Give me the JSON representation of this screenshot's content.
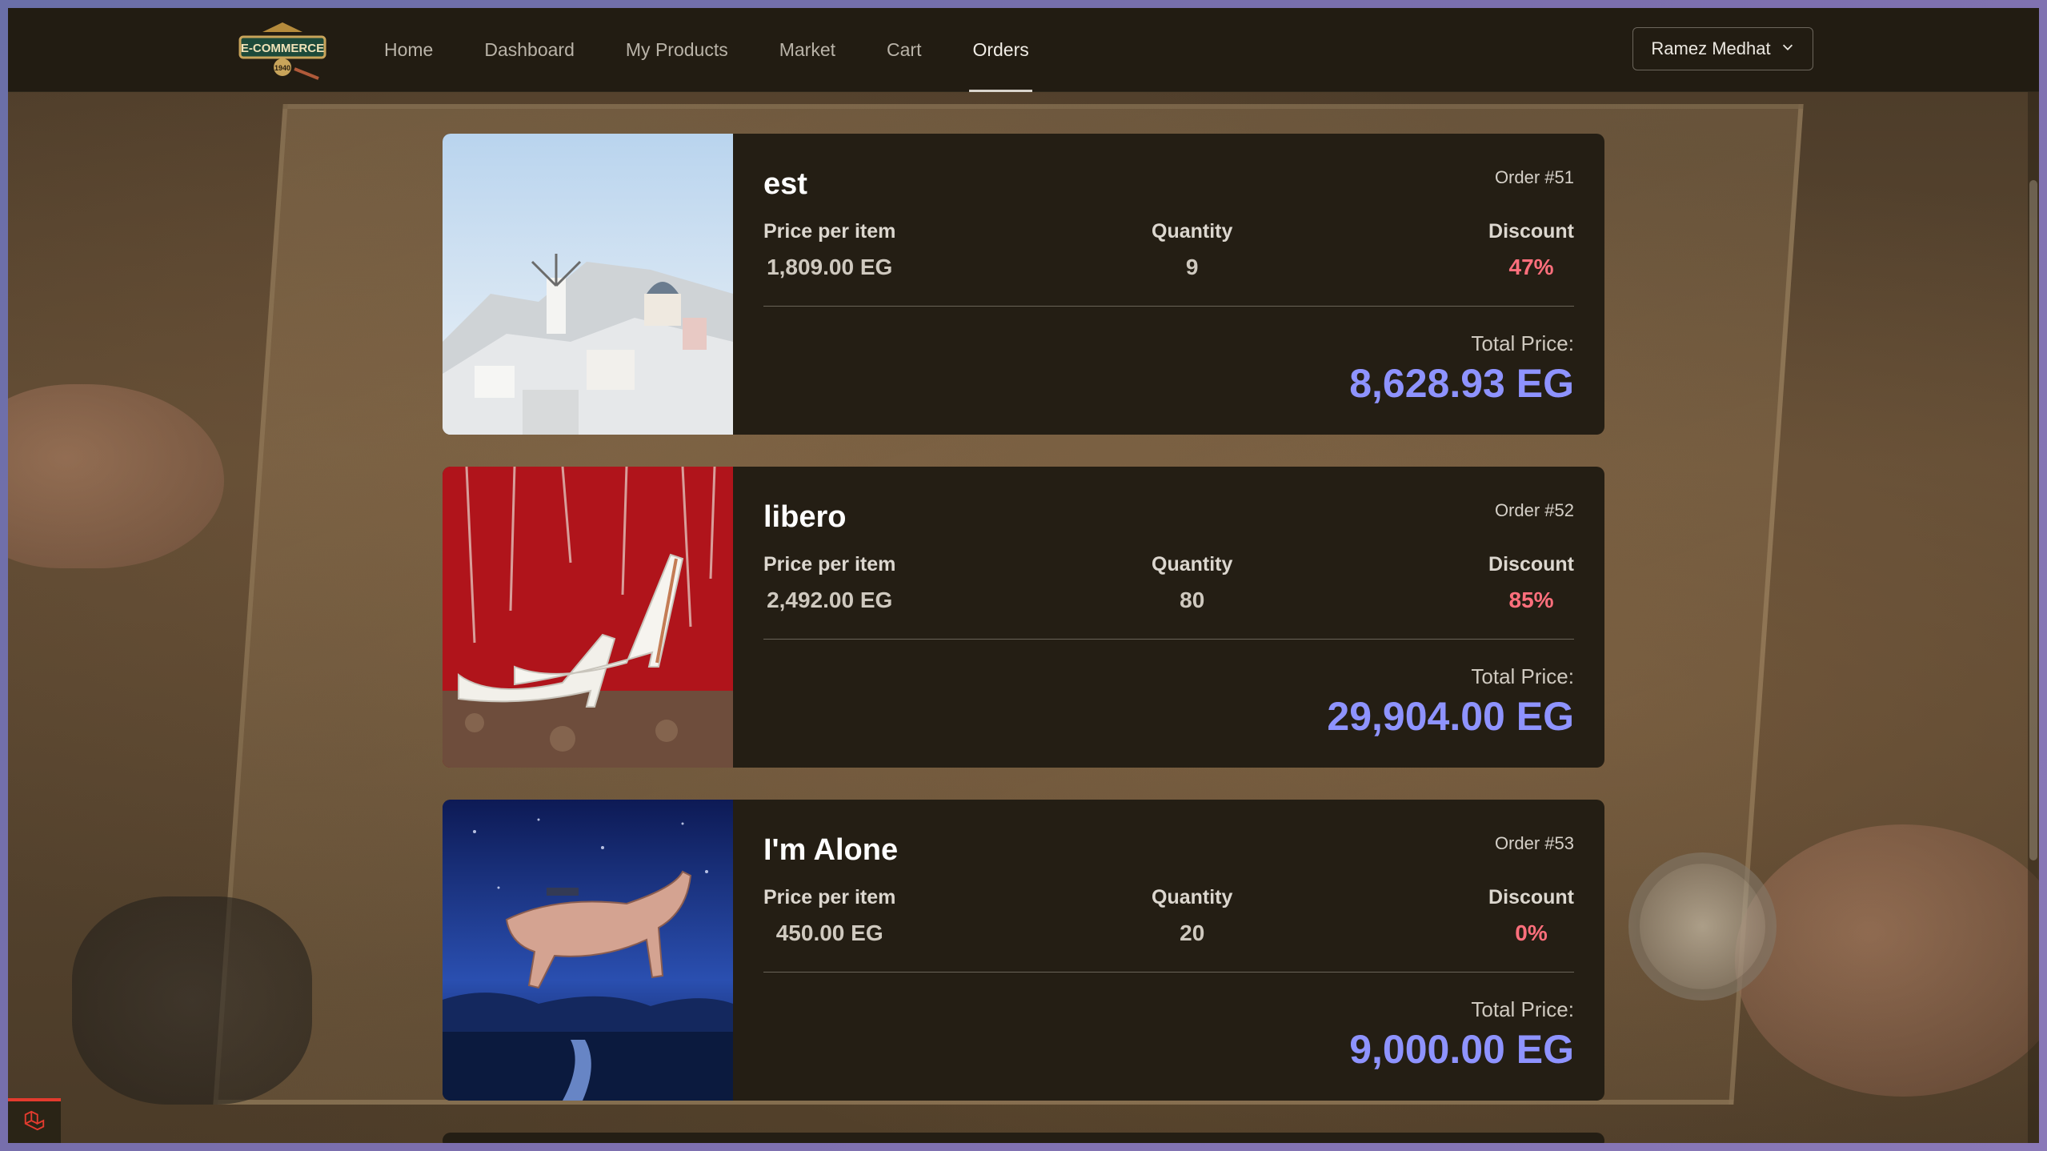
{
  "navbar": {
    "logo": {
      "main": "E-COMMERCE",
      "sub": "1940"
    },
    "links": [
      {
        "label": "Home",
        "active": false
      },
      {
        "label": "Dashboard",
        "active": false
      },
      {
        "label": "My Products",
        "active": false
      },
      {
        "label": "Market",
        "active": false
      },
      {
        "label": "Cart",
        "active": false
      },
      {
        "label": "Orders",
        "active": true
      }
    ],
    "user": {
      "name": "Ramez Medhat"
    }
  },
  "labels": {
    "price": "Price per item",
    "quantity": "Quantity",
    "discount": "Discount",
    "total": "Total Price:"
  },
  "orders": [
    {
      "name": "est",
      "order_no": "Order #51",
      "price": "1,809.00 EG",
      "quantity": "9",
      "discount": "47%",
      "total": "8,628.93 EG",
      "image": "santorini-village"
    },
    {
      "name": "libero",
      "order_no": "Order #52",
      "price": "2,492.00 EG",
      "quantity": "80",
      "discount": "85%",
      "total": "29,904.00 EG",
      "image": "white-heels"
    },
    {
      "name": "I'm Alone",
      "order_no": "Order #53",
      "price": "450.00 EG",
      "quantity": "20",
      "discount": "0%",
      "total": "9,000.00 EG",
      "image": "flying-horse"
    }
  ],
  "colors": {
    "accent_total": "#8e93ff",
    "discount": "#ff6f7c",
    "card_bg": "#241e14",
    "navbar_bg": "#221c12"
  }
}
